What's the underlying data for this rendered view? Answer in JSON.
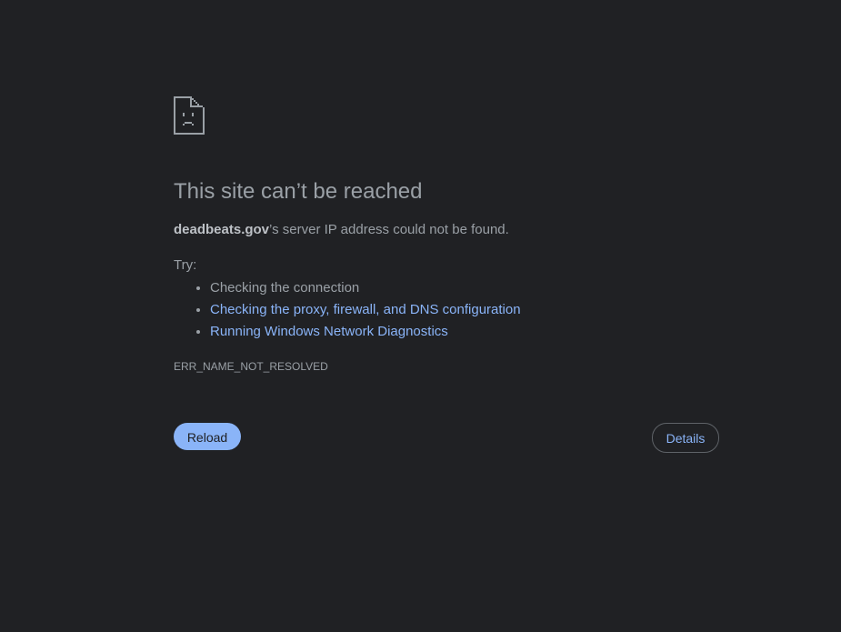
{
  "error": {
    "icon": "sad-document-icon",
    "title": "This site can’t be reached",
    "host": "deadbeats.gov",
    "message_suffix": "’s server IP address could not be found.",
    "try_label": "Try:",
    "suggestions": [
      {
        "text": "Checking the connection",
        "link": false
      },
      {
        "text": "Checking the proxy, firewall, and DNS configuration",
        "link": true
      },
      {
        "text": "Running Windows Network Diagnostics",
        "link": true
      }
    ],
    "code": "ERR_NAME_NOT_RESOLVED"
  },
  "buttons": {
    "reload_label": "Reload",
    "details_label": "Details"
  },
  "colors": {
    "background": "#202124",
    "text": "#9aa0a6",
    "link": "#8ab4f8",
    "primary_button": "#8ab4f8"
  }
}
